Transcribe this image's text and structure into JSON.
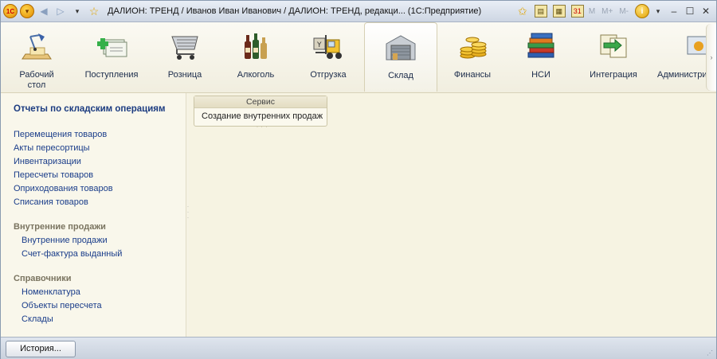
{
  "window": {
    "title": "ДАЛИОН: ТРЕНД / Иванов Иван Иванович / ДАЛИОН: ТРЕНД, редакци...  (1С:Предприятие)",
    "toolbar_m": [
      "M",
      "M+",
      "M-"
    ]
  },
  "sections": [
    {
      "label": "Рабочий стол",
      "icon": "desk-lamp-icon"
    },
    {
      "label": "Поступления",
      "icon": "money-in-icon"
    },
    {
      "label": "Розница",
      "icon": "shopping-cart-icon"
    },
    {
      "label": "Алкоголь",
      "icon": "bottles-icon"
    },
    {
      "label": "Отгрузка",
      "icon": "forklift-icon"
    },
    {
      "label": "Склад",
      "icon": "warehouse-icon",
      "active": true
    },
    {
      "label": "Финансы",
      "icon": "coins-icon"
    },
    {
      "label": "НСИ",
      "icon": "books-icon"
    },
    {
      "label": "Интеграция",
      "icon": "exchange-icon"
    },
    {
      "label": "Администри",
      "icon": "admin-icon"
    }
  ],
  "leftnav": {
    "header": "Отчеты по складским операциям",
    "items": [
      "Перемещения товаров",
      "Акты пересортицы",
      "Инвентаризации",
      "Пересчеты товаров",
      "Оприходования товаров",
      "Списания товаров"
    ],
    "group1": {
      "title": "Внутренние продажи",
      "items": [
        "Внутренние продажи",
        "Счет-фактура выданный"
      ]
    },
    "group2": {
      "title": "Справочники",
      "items": [
        "Номенклатура",
        "Объекты пересчета",
        "Склады"
      ]
    }
  },
  "service": {
    "title": "Сервис",
    "item": "Создание внутренних продаж"
  },
  "bottom": {
    "history_button": "История..."
  },
  "colors": {
    "link": "#1a3d8a",
    "header": "#1b3b80",
    "group": "#7a7460",
    "background": "#f6f3e4"
  }
}
